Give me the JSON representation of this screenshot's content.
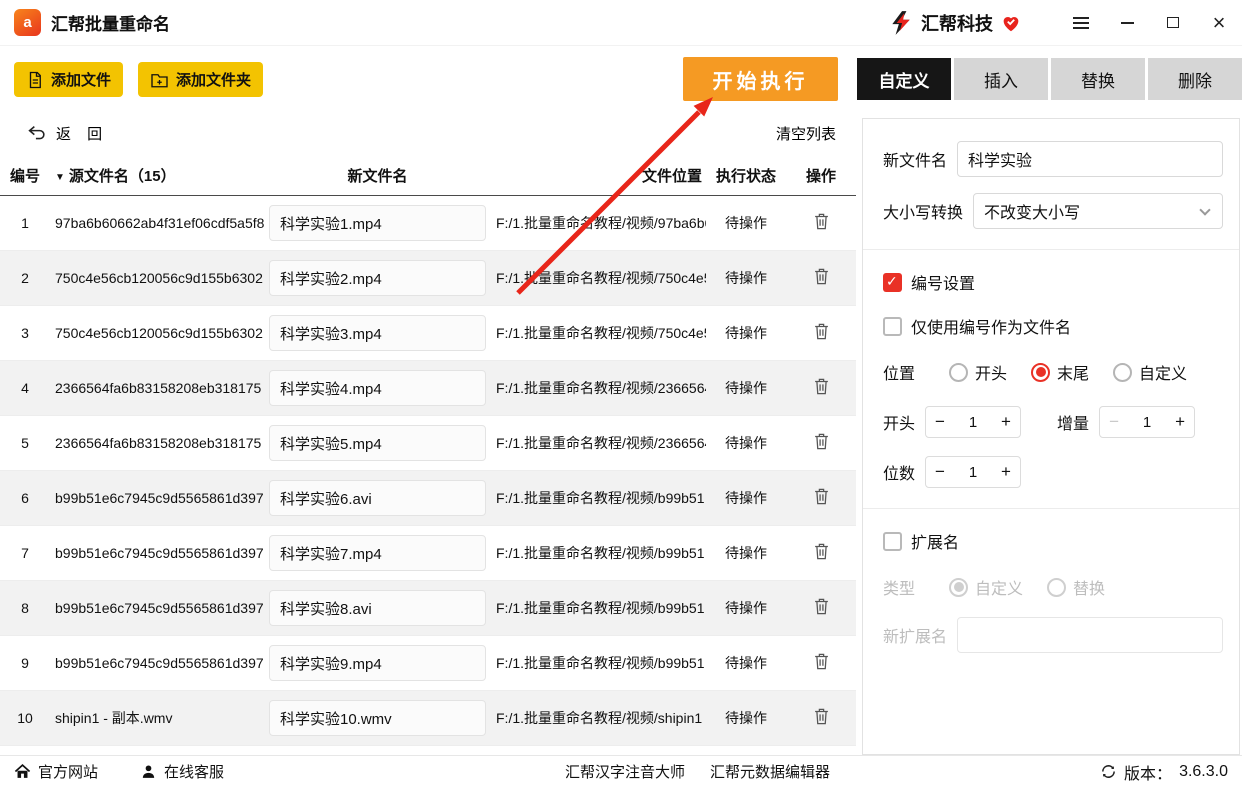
{
  "colors": {
    "accent_red": "#e93126",
    "button_yellow": "#f3c301",
    "button_orange": "#f59a23",
    "tab_active_bg": "#161616",
    "tab_inactive_bg": "#d6d6d6",
    "row_alt_bg": "#f2f2f2",
    "arrow_red": "#e8261a"
  },
  "titlebar": {
    "app_title": "汇帮批量重命名",
    "brand": "汇帮科技"
  },
  "toolbar": {
    "add_file": "添加文件",
    "add_folder": "添加文件夹",
    "start": "开始执行",
    "tabs": [
      {
        "label": "自定义",
        "active": true
      },
      {
        "label": "插入",
        "active": false
      },
      {
        "label": "替换",
        "active": false
      },
      {
        "label": "删除",
        "active": false
      }
    ]
  },
  "list_header": {
    "back": "返 回",
    "clear": "清空列表"
  },
  "table": {
    "columns": [
      "编号",
      "源文件名（15）",
      "新文件名",
      "文件位置",
      "执行状态",
      "操作"
    ],
    "rows": [
      {
        "no": "1",
        "source": "97ba6b60662ab4f31ef06cdf5a5f8",
        "new_name": "科学实验1.mp4",
        "location": "F:/1.批量重命名教程/视频/97ba6b6",
        "status": "待操作"
      },
      {
        "no": "2",
        "source": "750c4e56cb120056c9d155b6302",
        "new_name": "科学实验2.mp4",
        "location": "F:/1.批量重命名教程/视频/750c4e5",
        "status": "待操作"
      },
      {
        "no": "3",
        "source": "750c4e56cb120056c9d155b6302",
        "new_name": "科学实验3.mp4",
        "location": "F:/1.批量重命名教程/视频/750c4e5",
        "status": "待操作"
      },
      {
        "no": "4",
        "source": "2366564fa6b83158208eb318175",
        "new_name": "科学实验4.mp4",
        "location": "F:/1.批量重命名教程/视频/2366564",
        "status": "待操作"
      },
      {
        "no": "5",
        "source": "2366564fa6b83158208eb318175",
        "new_name": "科学实验5.mp4",
        "location": "F:/1.批量重命名教程/视频/2366564",
        "status": "待操作"
      },
      {
        "no": "6",
        "source": "b99b51e6c7945c9d5565861d397",
        "new_name": "科学实验6.avi",
        "location": "F:/1.批量重命名教程/视频/b99b51",
        "status": "待操作"
      },
      {
        "no": "7",
        "source": "b99b51e6c7945c9d5565861d397",
        "new_name": "科学实验7.mp4",
        "location": "F:/1.批量重命名教程/视频/b99b51",
        "status": "待操作"
      },
      {
        "no": "8",
        "source": "b99b51e6c7945c9d5565861d397",
        "new_name": "科学实验8.avi",
        "location": "F:/1.批量重命名教程/视频/b99b51",
        "status": "待操作"
      },
      {
        "no": "9",
        "source": "b99b51e6c7945c9d5565861d397",
        "new_name": "科学实验9.mp4",
        "location": "F:/1.批量重命名教程/视频/b99b51",
        "status": "待操作"
      },
      {
        "no": "10",
        "source": "shipin1 - 副本.wmv",
        "new_name": "科学实验10.wmv",
        "location": "F:/1.批量重命名教程/视频/shipin1",
        "status": "待操作"
      }
    ]
  },
  "panel": {
    "new_name_label": "新文件名",
    "new_name_value": "科学实验",
    "case_label": "大小写转换",
    "case_value": "不改变大小写",
    "numbering": {
      "label": "编号设置",
      "checked": true
    },
    "only_number": {
      "label": "仅使用编号作为文件名",
      "checked": false
    },
    "position": {
      "label": "位置",
      "options": [
        "开头",
        "末尾",
        "自定义"
      ],
      "selected": "末尾"
    },
    "start": {
      "label": "开头",
      "value": "1"
    },
    "increment": {
      "label": "增量",
      "value": "1"
    },
    "digits": {
      "label": "位数",
      "value": "1"
    },
    "extension": {
      "label": "扩展名",
      "checked": false
    },
    "type": {
      "label": "类型",
      "options": [
        "自定义",
        "替换"
      ],
      "selected": "自定义"
    },
    "new_ext": {
      "label": "新扩展名",
      "value": ""
    }
  },
  "statusbar": {
    "official_site": "官方网站",
    "online_service": "在线客服",
    "link_pinyin": "汇帮汉字注音大师",
    "link_metadata": "汇帮元数据编辑器",
    "version_label": "版本：",
    "version": "3.6.3.0"
  }
}
